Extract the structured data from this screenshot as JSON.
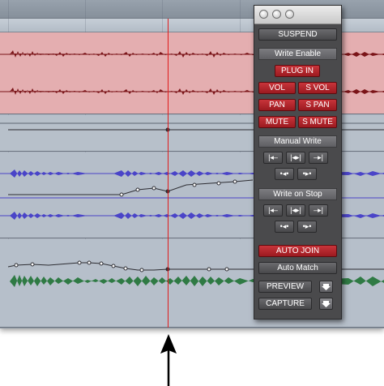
{
  "window": {
    "title_buttons": [
      "close",
      "minimize",
      "zoom"
    ]
  },
  "automation": {
    "suspend_label": "SUSPEND",
    "write_enable_label": "Write Enable",
    "plugin_label": "PLUG IN",
    "vol_label": "VOL",
    "svol_label": "S VOL",
    "pan_label": "PAN",
    "span_label": "S PAN",
    "mute_label": "MUTE",
    "smute_label": "S MUTE",
    "manual_write_label": "Manual Write",
    "write_on_stop_label": "Write on Stop",
    "auto_join_label": "AUTO JOIN",
    "auto_match_label": "Auto Match",
    "preview_label": "PREVIEW",
    "capture_label": "CAPTURE"
  },
  "colors": {
    "red_track": "#e4aeb0",
    "red_wave": "#7a1418",
    "blue_wave": "#4a44c8",
    "green_wave": "#2f7a44",
    "playhead": "#e01c1c",
    "enabled_button": "#b8262c"
  },
  "icons": {
    "manual_write": [
      "write-to-start-icon",
      "write-to-all-icon",
      "write-to-end-icon",
      "write-punch-back-icon",
      "write-punch-forward-icon"
    ],
    "write_on_stop": [
      "stop-to-start-icon",
      "stop-to-all-icon",
      "stop-to-end-icon",
      "stop-punch-back-icon",
      "stop-punch-forward-icon"
    ],
    "preview_arrow": "down-arrow-icon",
    "capture_arrow": "down-arrow-icon",
    "callout": "up-arrow-icon"
  }
}
